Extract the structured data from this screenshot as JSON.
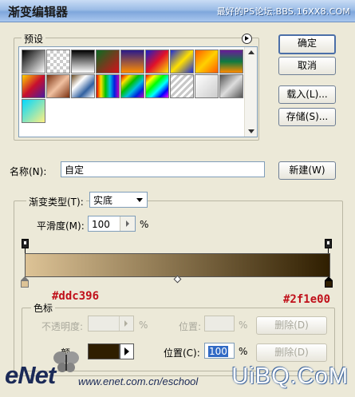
{
  "window": {
    "title": "渐变编辑器",
    "watermark": "最好的PS论坛:BBS.16XX8.COM"
  },
  "presets": {
    "label": "预设",
    "menu_icon": "circle-arrow-right-icon",
    "swatches": [
      {
        "name": "black-white",
        "css": "linear-gradient(135deg,#000,#fff)"
      },
      {
        "name": "transparent",
        "css": "repeating-conic-gradient(#ccc 0 25%, #fff 0 50%) 0 0/8px 8px"
      },
      {
        "name": "black-white-2",
        "css": "linear-gradient(180deg,#000,#fff)"
      },
      {
        "name": "red-green",
        "css": "linear-gradient(135deg,#0a6b22,#d6101a)"
      },
      {
        "name": "violet-orange",
        "css": "linear-gradient(180deg,#2a1a8a,#ff8c00)"
      },
      {
        "name": "blue-red-yellow",
        "css": "linear-gradient(135deg,#1520c8,#e0102a,#ffe600)"
      },
      {
        "name": "blue-yellow-blue",
        "css": "linear-gradient(135deg,#1a2ad8,#ffe000,#1a2ad8)"
      },
      {
        "name": "orange-yellow",
        "css": "linear-gradient(135deg,#ff5a00,#ffd000,#ff5a00)"
      },
      {
        "name": "violet-green-orange",
        "css": "linear-gradient(180deg,#6a1a9a,#0d7a40,#ff8a00)"
      },
      {
        "name": "yellow-violet",
        "css": "linear-gradient(135deg,#ffd000,#c8102e,#4a1aa0)"
      },
      {
        "name": "copper",
        "css": "linear-gradient(135deg,#7a3010,#f0c0a0,#7a3010)"
      },
      {
        "name": "chrome",
        "css": "linear-gradient(135deg,#6a4a20,#fff,#3060a0,#fff)"
      },
      {
        "name": "spectrum",
        "css": "linear-gradient(90deg,#e00000,#ffe000,#00c000,#00c0e0,#0020e0,#c000c0)"
      },
      {
        "name": "spectrum-diag",
        "css": "linear-gradient(135deg,#e00000,#ffe000,#00c000,#00c0e0,#0020e0,#c000c0)"
      },
      {
        "name": "transparent-rainbow",
        "css": "linear-gradient(135deg,#ff0000,#ffff00,#00ff00,#00ffff,#0000ff,#ff00ff)"
      },
      {
        "name": "transparent-stripes",
        "css": "repeating-linear-gradient(135deg,#c8c8c8 0 3px,#fff 3px 6px)"
      },
      {
        "name": "neutral-density",
        "css": "linear-gradient(135deg,#ffffff,#cccccc)"
      },
      {
        "name": "foreground-transparent",
        "css": "linear-gradient(135deg,#555,#ddd,#555)"
      },
      {
        "name": "cyan-yellow",
        "css": "linear-gradient(135deg,#00d8ff,#fff080)"
      }
    ]
  },
  "buttons": {
    "ok": "确定",
    "cancel": "取消",
    "load": "载入(L)...",
    "save": "存储(S)...",
    "new": "新建(W)"
  },
  "name_field": {
    "label": "名称(N):",
    "value": "自定"
  },
  "gradient_type": {
    "label": "渐变类型(T):",
    "value": "实底"
  },
  "smoothness": {
    "label": "平滑度(M):",
    "value": "100",
    "unit": "%"
  },
  "gradient": {
    "start_color": "#ddc396",
    "end_color": "#2f1e00",
    "start_label": "#ddc396",
    "end_label": "#2f1e00"
  },
  "stops": {
    "legend": "色标",
    "opacity_label": "不透明度:",
    "opacity_unit": "%",
    "location_label_top": "位置:",
    "location_unit_top": "%",
    "delete_label_top": "删除(D)",
    "color_label": "颜",
    "color_value": "#2f1e00",
    "location_label": "位置(C):",
    "location_value": "100",
    "location_unit": "%",
    "delete_label": "删除(D)"
  },
  "footer": {
    "enet_logo": "eNet",
    "enet_url": "www.enet.com.cn/eschool",
    "uibq_logo": "UiBQ.CoM"
  }
}
